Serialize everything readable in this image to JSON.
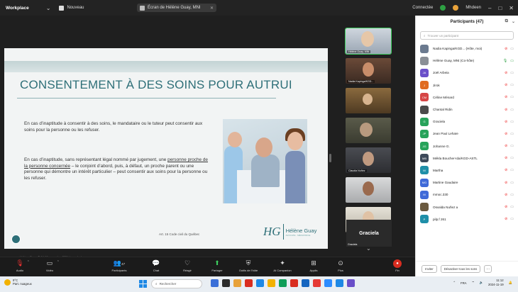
{
  "titlebar": {
    "app": "Workplace",
    "new_label": "Nouveau",
    "tab_title": "Écran de Hélène Guay, MNI",
    "tab_close": "✕",
    "connection": "Connectée",
    "user": "Mhdeen",
    "win_min": "–",
    "win_max": "□",
    "win_close": "✕"
  },
  "slide": {
    "title": "CONSENTEMENT À DES SOINS POUR AUTRUI",
    "para1": "En cas d’inaptitude à consentir à des soins, le mandataire ou le tuteur peut consentir aux soins pour la personne ou les refuser.",
    "para2_a": "En cas d’inaptitude, sans représentant légal nommé par jugement, une ",
    "para2_u": "personne proche de la personne concernée",
    "para2_b": " – le conjoint d’abord, puis, à défaut, un proche parent ou une personne qui démontre un intérêt particulier – peut consentir aux soins pour la personne ou les refuser.",
    "citation": "Art. 15 Code civil du Québec",
    "footer": "Hélène Guay, © 14-19 novembre 2024 | www.heleneguay.com",
    "logo_mark": "HG",
    "logo_name": "Hélène Guay",
    "logo_sub": "AVOCATE · MÉDIATRICE"
  },
  "gallery": {
    "tiles": [
      {
        "name": "Hélène Guay, MNt",
        "active": true
      },
      {
        "name": "Nadia Kapinga/KGD...",
        "active": false
      },
      {
        "name": "",
        "active": false
      },
      {
        "name": "",
        "active": false
      },
      {
        "name": "Claudia Nuñez",
        "active": false
      },
      {
        "name": "",
        "active": false
      },
      {
        "name": "Chantal Ridin",
        "active": false
      }
    ],
    "named_tile": {
      "big": "Graciela",
      "small": "Graciela"
    }
  },
  "panel": {
    "title": "Participants (47)",
    "search_placeholder": "Trouver un participant",
    "participants": [
      {
        "name": "Nadia Kapinga/KGD... (Hôte, moi)",
        "color": "#6b7a8f",
        "initials": "",
        "mic": "off",
        "cam": "off"
      },
      {
        "name": "Hélène Guay, MNt (Co-hôte)",
        "color": "#8a8f96",
        "initials": "",
        "mic": "on",
        "cam": "on"
      },
      {
        "name": "Joël Arbeia",
        "color": "#6a4fc9",
        "initials": "JA",
        "mic": "off",
        "cam": "off"
      },
      {
        "name": "Jirok",
        "color": "#e06b1f",
        "initials": "J",
        "mic": "off",
        "cam": "off"
      },
      {
        "name": "Céline Ménard",
        "color": "#d64545",
        "initials": "CM",
        "mic": "off",
        "cam": "off"
      },
      {
        "name": "Chantal Ridin",
        "color": "#4a4a4a",
        "initials": "",
        "mic": "off",
        "cam": "off"
      },
      {
        "name": "Graciela",
        "color": "#27a35a",
        "initials": "G",
        "mic": "off",
        "cam": "off"
      },
      {
        "name": "Jean Paul Lehaïe",
        "color": "#27a35a",
        "initials": "JP",
        "mic": "off",
        "cam": "off"
      },
      {
        "name": "Johanne G.",
        "color": "#27a35a",
        "initials": "JG",
        "mic": "off",
        "cam": "off"
      },
      {
        "name": "Mékla Boucher-Ida/KGD-ASTL",
        "color": "#3d4a5a",
        "initials": "MB",
        "mic": "off",
        "cam": "off"
      },
      {
        "name": "Martha",
        "color": "#1f8fa8",
        "initials": "M",
        "mic": "off",
        "cam": "off"
      },
      {
        "name": "Martine Gaudaire",
        "color": "#3f6ad8",
        "initials": "MG",
        "mic": "off",
        "cam": "off"
      },
      {
        "name": "mmoc.330",
        "color": "#3f6ad8",
        "initials": "M",
        "mic": "off",
        "cam": "off"
      },
      {
        "name": "Osvalda Nuñez a",
        "color": "#6b5a40",
        "initials": "",
        "mic": "off",
        "cam": "off"
      },
      {
        "name": "pilp.f 261",
        "color": "#1f8fa8",
        "initials": "P",
        "mic": "off",
        "cam": "off"
      }
    ],
    "invite": "Inviter",
    "mute_all": "Désactiver tous les sons",
    "more": "···"
  },
  "toolbar": {
    "audio": "Audio",
    "video": "Vidéo",
    "participants": "Participants",
    "participants_count": "47",
    "chat": "Chat",
    "react": "Réagir",
    "share": "Partager",
    "host_tools": "Outils de l’hôte",
    "ai_companion": "AI Companion",
    "apps": "Applis",
    "more": "Plus",
    "leave": "Fin"
  },
  "taskbar": {
    "weather_temp": "9°C",
    "weather_desc": "Part. nuageux",
    "search": "Rechercher",
    "lang": "FRA",
    "time": "11:12",
    "date": "2024-11-19"
  }
}
